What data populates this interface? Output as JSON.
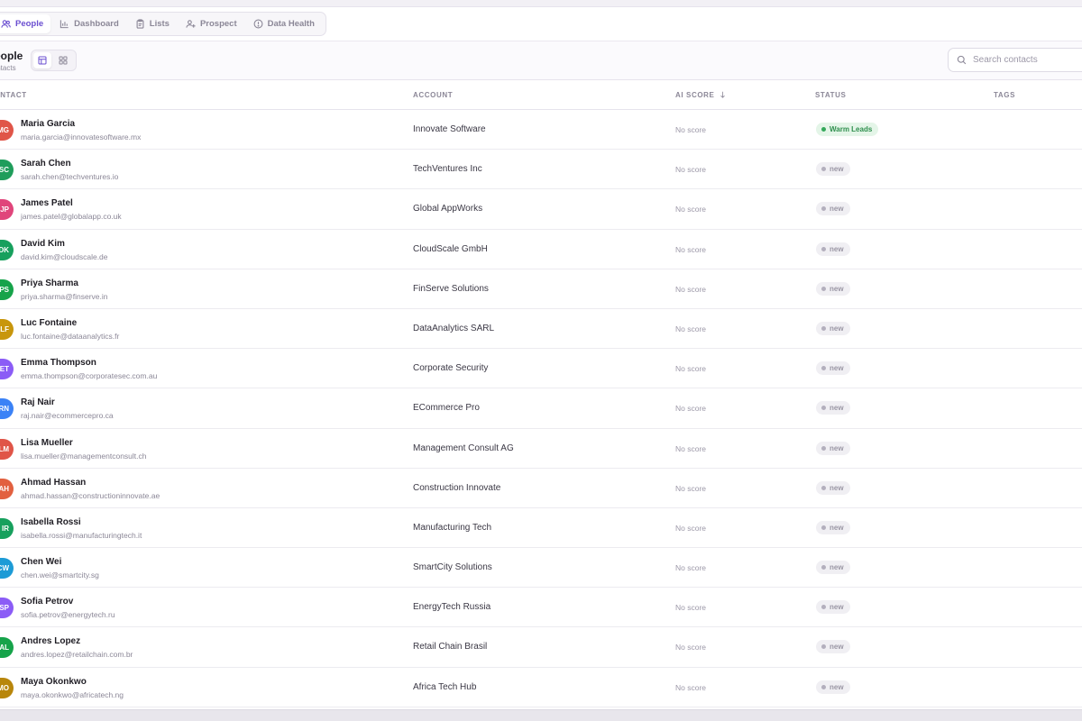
{
  "nav": {
    "items": [
      {
        "label": "People",
        "icon": "people-icon",
        "active": true
      },
      {
        "label": "Dashboard",
        "icon": "bar-chart-icon",
        "active": false
      },
      {
        "label": "Lists",
        "icon": "clipboard-icon",
        "active": false
      },
      {
        "label": "Prospect",
        "icon": "user-plus-icon",
        "active": false
      },
      {
        "label": "Data Health",
        "icon": "info-circle-icon",
        "active": false
      }
    ]
  },
  "page": {
    "title": "People",
    "subtitle": "Contacts"
  },
  "search": {
    "placeholder": "Search contacts",
    "value": ""
  },
  "table": {
    "columns": {
      "contact": "Contact",
      "account": "Account",
      "ai_score": "AI Score",
      "status": "Status",
      "tags": "Tags"
    },
    "rows": [
      {
        "initials": "MG",
        "name": "Maria Garcia",
        "email": "maria.garcia@innovatesoftware.mx",
        "account": "Innovate Software",
        "score": "No score",
        "status": "Warm Leads",
        "status_type": "warm",
        "avatar_color": "#e05548"
      },
      {
        "initials": "SC",
        "name": "Sarah Chen",
        "email": "sarah.chen@techventures.io",
        "account": "TechVentures Inc",
        "score": "No score",
        "status": "new",
        "status_type": "new",
        "avatar_color": "#1f9d5b"
      },
      {
        "initials": "JP",
        "name": "James Patel",
        "email": "james.patel@globalapp.co.uk",
        "account": "Global AppWorks",
        "score": "No score",
        "status": "new",
        "status_type": "new",
        "avatar_color": "#e0457b"
      },
      {
        "initials": "DK",
        "name": "David Kim",
        "email": "david.kim@cloudscale.de",
        "account": "CloudScale GmbH",
        "score": "No score",
        "status": "new",
        "status_type": "new",
        "avatar_color": "#17a05d"
      },
      {
        "initials": "PS",
        "name": "Priya Sharma",
        "email": "priya.sharma@finserve.in",
        "account": "FinServe Solutions",
        "score": "No score",
        "status": "new",
        "status_type": "new",
        "avatar_color": "#16a34a"
      },
      {
        "initials": "LF",
        "name": "Luc Fontaine",
        "email": "luc.fontaine@dataanalytics.fr",
        "account": "DataAnalytics SARL",
        "score": "No score",
        "status": "new",
        "status_type": "new",
        "avatar_color": "#c8960c"
      },
      {
        "initials": "ET",
        "name": "Emma Thompson",
        "email": "emma.thompson@corporatesec.com.au",
        "account": "Corporate Security",
        "score": "No score",
        "status": "new",
        "status_type": "new",
        "avatar_color": "#8b5cf6"
      },
      {
        "initials": "RN",
        "name": "Raj Nair",
        "email": "raj.nair@ecommercepro.ca",
        "account": "ECommerce Pro",
        "score": "No score",
        "status": "new",
        "status_type": "new",
        "avatar_color": "#3b82f6"
      },
      {
        "initials": "LM",
        "name": "Lisa Mueller",
        "email": "lisa.mueller@managementconsult.ch",
        "account": "Management Consult AG",
        "score": "No score",
        "status": "new",
        "status_type": "new",
        "avatar_color": "#e05548"
      },
      {
        "initials": "AH",
        "name": "Ahmad Hassan",
        "email": "ahmad.hassan@constructioninnovate.ae",
        "account": "Construction Innovate",
        "score": "No score",
        "status": "new",
        "status_type": "new",
        "avatar_color": "#e2603f"
      },
      {
        "initials": "IR",
        "name": "Isabella Rossi",
        "email": "isabella.rossi@manufacturingtech.it",
        "account": "Manufacturing Tech",
        "score": "No score",
        "status": "new",
        "status_type": "new",
        "avatar_color": "#17a05d"
      },
      {
        "initials": "CW",
        "name": "Chen Wei",
        "email": "chen.wei@smartcity.sg",
        "account": "SmartCity Solutions",
        "score": "No score",
        "status": "new",
        "status_type": "new",
        "avatar_color": "#1d9bd6"
      },
      {
        "initials": "SP",
        "name": "Sofia Petrov",
        "email": "sofia.petrov@energytech.ru",
        "account": "EnergyTech Russia",
        "score": "No score",
        "status": "new",
        "status_type": "new",
        "avatar_color": "#8b5cf6"
      },
      {
        "initials": "AL",
        "name": "Andres Lopez",
        "email": "andres.lopez@retailchain.com.br",
        "account": "Retail Chain Brasil",
        "score": "No score",
        "status": "new",
        "status_type": "new",
        "avatar_color": "#16a34a"
      },
      {
        "initials": "MO",
        "name": "Maya Okonkwo",
        "email": "maya.okonkwo@africatech.ng",
        "account": "Africa Tech Hub",
        "score": "No score",
        "status": "new",
        "status_type": "new",
        "avatar_color": "#b8860b"
      }
    ]
  },
  "colors": {
    "accent": "#6b4fd1",
    "warm_status": "#2f8f4e",
    "muted_text": "#8b8797"
  }
}
